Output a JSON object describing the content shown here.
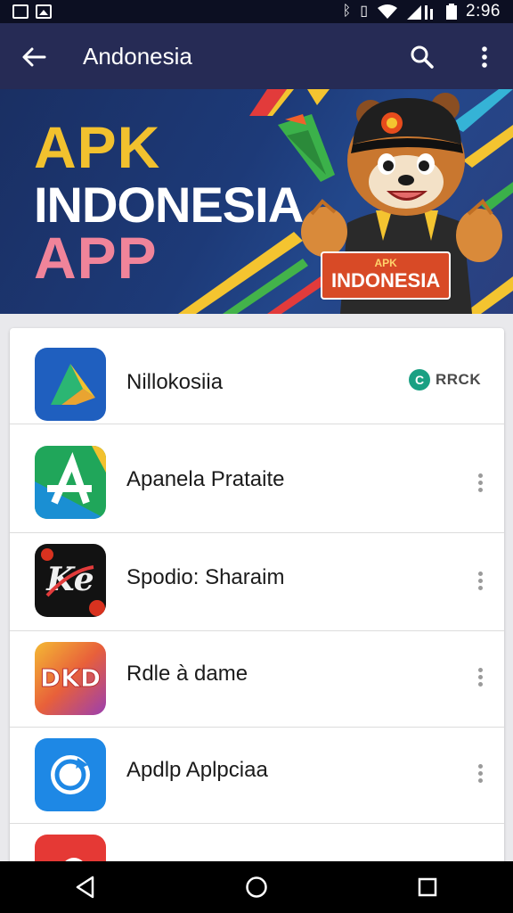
{
  "status_bar": {
    "time": "2:96",
    "icons": [
      "gallery-icon",
      "image-icon",
      "bluetooth-icon",
      "vibrate-icon",
      "wifi-icon",
      "signal-icon",
      "battery-icon"
    ]
  },
  "app_bar": {
    "title": "Andonesia",
    "background": "#262b55"
  },
  "banner": {
    "line1": "APK",
    "line2": "INDONESIA",
    "line3": "APP",
    "mascot_badge_top": "APK",
    "mascot_badge_main": "INDONESIA"
  },
  "apps": [
    {
      "name": "Nillokosiia",
      "badge_letter": "C",
      "badge_label": "RRCK",
      "icon": "drive-triangle-icon"
    },
    {
      "name": "Apanela Prataite",
      "icon": "letter-a-icon"
    },
    {
      "name": "Spodio: Sharaim",
      "icon": "ke-logo-icon"
    },
    {
      "name": "Rdle à dame",
      "icon": "dkd-logo-icon"
    },
    {
      "name": "Apdlp Aplpciaa",
      "icon": "refresh-circle-icon"
    },
    {
      "name": "",
      "icon": "red-app-icon"
    }
  ],
  "nav": [
    "back-triangle-icon",
    "home-circle-icon",
    "recents-square-icon"
  ]
}
